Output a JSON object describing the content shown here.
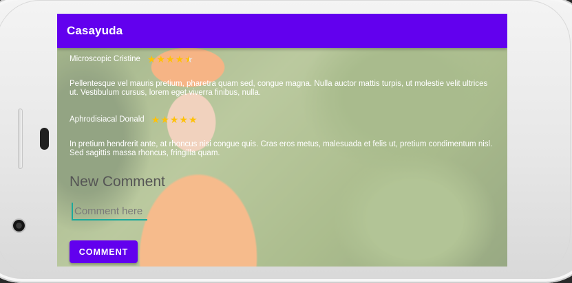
{
  "app": {
    "title": "Casayuda"
  },
  "reviews": [
    {
      "name": "Microscopic Cristine",
      "rating": 4.5,
      "text": "Pellentesque vel mauris pretium, pharetra quam sed, congue magna. Nulla auctor mattis turpis, ut molestie velit ultrices ut. Vestibulum cursus, lorem eget viverra finibus, nulla."
    },
    {
      "name": "Aphrodisiacal Donald",
      "rating": 5,
      "text": "In pretium hendrerit ante, at rhoncus nisi congue quis. Cras eros metus, malesuada et felis ut, pretium condimentum nisl. Sed sagittis massa rhoncus, fringilla quam."
    }
  ],
  "new_comment": {
    "title": "New Comment",
    "placeholder": "Comment here",
    "button_label": "COMMENT"
  },
  "status": {
    "top_left": "100"
  },
  "colors": {
    "primary": "#6200ee",
    "accent": "#1ba99b",
    "star": "#ffc107"
  }
}
